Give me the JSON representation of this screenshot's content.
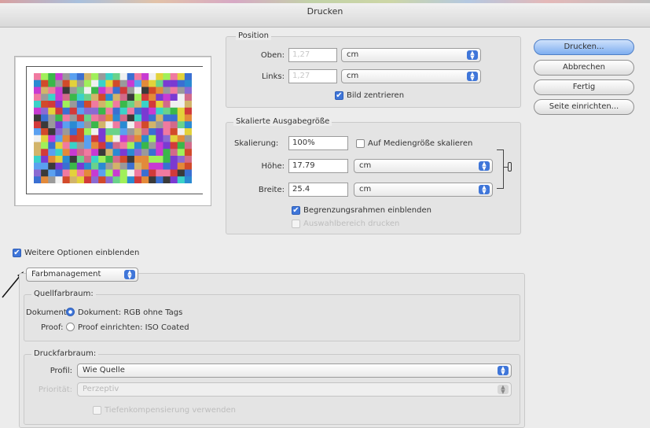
{
  "window": {
    "title": "Drucken"
  },
  "buttons": {
    "print": "Drucken...",
    "cancel": "Abbrechen",
    "done": "Fertig",
    "page_setup": "Seite einrichten..."
  },
  "position": {
    "group_label": "Position",
    "top_label": "Oben:",
    "top_value": "1,27",
    "top_unit": "cm",
    "left_label": "Links:",
    "left_value": "1,27",
    "left_unit": "cm",
    "center_label": "Bild zentrieren",
    "center_checked": true
  },
  "scaled": {
    "group_label": "Skalierte Ausgabegröße",
    "scale_label": "Skalierung:",
    "scale_value": "100%",
    "fit_label": "Auf Mediengröße skalieren",
    "fit_checked": false,
    "height_label": "Höhe:",
    "height_value": "17.79",
    "height_unit": "cm",
    "width_label": "Breite:",
    "width_value": "25.4",
    "width_unit": "cm",
    "bbox_label": "Begrenzungsrahmen einblenden",
    "bbox_checked": true,
    "selection_label": "Auswahlbereich drucken",
    "selection_checked": false
  },
  "more_options": {
    "label": "Weitere Optionen einblenden",
    "checked": true
  },
  "mode_popup": {
    "value": "Farbmanagement"
  },
  "source_space": {
    "group_label": "Quellfarbraum:",
    "document_label": "Dokument:",
    "document_option": "Dokument: RGB ohne Tags",
    "proof_label": "Proof:",
    "proof_option": "Proof einrichten: ISO Coated"
  },
  "print_space": {
    "group_label": "Druckfarbraum:",
    "profile_label": "Profil:",
    "profile_value": "Wie Quelle",
    "priority_label": "Priorität:",
    "priority_value": "Perzeptiv",
    "bpc_label": "Tiefenkompensierung verwenden"
  },
  "colors": {
    "accent": "#3f76d9",
    "background": "#ececec"
  },
  "icons": [
    "link-chain-icon",
    "callout-arrow-icon",
    "checkmark-icon",
    "popup-arrows-icon"
  ]
}
